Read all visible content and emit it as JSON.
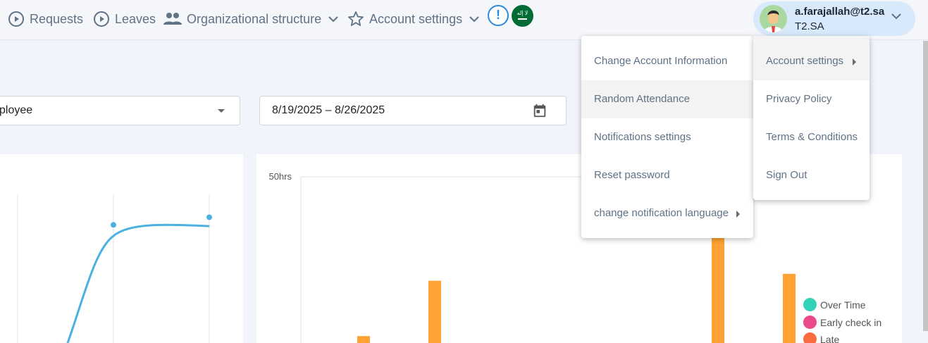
{
  "nav": {
    "requests": "Requests",
    "leaves": "Leaves",
    "org_structure": "Organizational structure",
    "account_settings": "Account settings"
  },
  "alert": {
    "symbol": "!"
  },
  "flag": {
    "text": "لا إله"
  },
  "user": {
    "email": "a.farajallah@t2.sa",
    "org": "T2.SA"
  },
  "filters": {
    "employee_value": "Employee",
    "date_range": "8/19/2025 – 8/26/2025"
  },
  "chart_right": {
    "y_top_label": "50hrs"
  },
  "chart_data": [
    {
      "type": "line",
      "title": "",
      "xlabel": "",
      "ylabel": "",
      "series": [
        {
          "values": [
            null,
            null,
            0.1,
            0.62,
            0.66
          ]
        }
      ],
      "grid": true
    },
    {
      "type": "bar",
      "title": "",
      "xlabel": "",
      "ylabel": "",
      "y_tick_labels": [
        "50hrs"
      ],
      "series": [
        {
          "name": "Late",
          "values": [
            2,
            18,
            0,
            0,
            0,
            0,
            43,
            20
          ]
        }
      ],
      "legend": [
        "Over Time",
        "Early check in",
        "Late"
      ],
      "legend_position": "right",
      "grid": true
    }
  ],
  "legend": [
    {
      "label": "Over Time",
      "color": "#33d1b8"
    },
    {
      "label": "Early check in",
      "color": "#e84a8a"
    },
    {
      "label": "Late",
      "color": "#fc6b3f"
    }
  ],
  "colors": {
    "bar": "#ffa133",
    "line": "#4bb1e1",
    "accent_blue": "#2b8ae0",
    "flag_green": "#006c35"
  },
  "menu_main": [
    {
      "label": "Change Account Information"
    },
    {
      "label": "Random Attendance"
    },
    {
      "label": "Notifications settings"
    },
    {
      "label": "Reset password"
    },
    {
      "label": "change notification language"
    }
  ],
  "menu_sub": [
    {
      "label": "Account settings"
    },
    {
      "label": "Privacy Policy"
    },
    {
      "label": "Terms & Conditions"
    },
    {
      "label": "Sign Out"
    }
  ]
}
